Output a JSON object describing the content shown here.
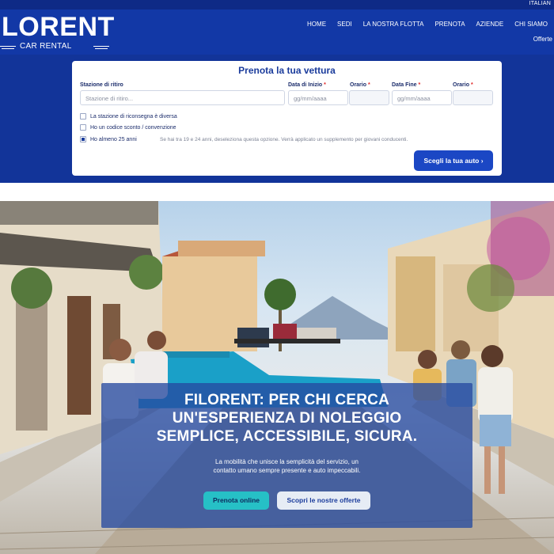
{
  "lang": "ITALIAN",
  "logo": {
    "brand": "LORENT",
    "sub": "CAR RENTAL"
  },
  "nav": [
    {
      "label": "HOME"
    },
    {
      "label": "SEDI"
    },
    {
      "label": "LA NOSTRA FLOTTA"
    },
    {
      "label": "PRENOTA"
    },
    {
      "label": "AZIENDE"
    },
    {
      "label": "CHI SIAMO"
    }
  ],
  "offers_label": "Offerte",
  "booking": {
    "title": "Prenota la tua vettura",
    "pickup_label": "Stazione di ritiro",
    "pickup_placeholder": "Stazione di ritiro...",
    "start_label": "Data di Inizio",
    "start_placeholder": "gg/mm/aaaa",
    "start_time_label": "Orario",
    "end_label": "Data Fine",
    "end_placeholder": "gg/mm/aaaa",
    "end_time_label": "Orario",
    "required_mark": "*",
    "check_return": "La stazione di riconsegna è diversa",
    "check_discount": "Ho un codice sconto / convenzione",
    "check_age": "Ho almeno 25 anni",
    "age_checked": true,
    "age_hint": "Se hai tra 19 e 24 anni, deseleziona questa opzione. Verrà applicato un supplemento per giovani conducenti.",
    "submit": "Scegli la tua auto ›"
  },
  "hero": {
    "headline_1": "FILORENT: PER CHI CERCA",
    "headline_2": "UN'ESPERIENZA DI NOLEGGIO",
    "headline_3": "SEMPLICE, ACCESSIBILE, SICURA.",
    "desc_1": "La mobilità che unisce la semplicità del servizio, un",
    "desc_2": "contatto umano sempre presente e auto impeccabili.",
    "btn_primary": "Prenota online",
    "btn_secondary": "Scopri le nostre offerte"
  },
  "colors": {
    "header": "#1238a6",
    "band": "#123499",
    "accent": "#1b47c4",
    "teal": "#26c0c6"
  }
}
